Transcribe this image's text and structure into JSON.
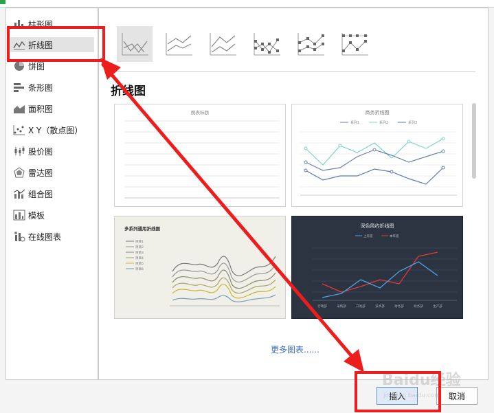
{
  "sidebar": {
    "items": [
      {
        "label": "柱形图",
        "icon": "bar-chart-icon"
      },
      {
        "label": "折线图",
        "icon": "line-chart-icon"
      },
      {
        "label": "饼图",
        "icon": "pie-chart-icon"
      },
      {
        "label": "条形图",
        "icon": "horizontal-bar-chart-icon"
      },
      {
        "label": "面积图",
        "icon": "area-chart-icon"
      },
      {
        "label": "X Y（散点图）",
        "icon": "scatter-chart-icon"
      },
      {
        "label": "股价图",
        "icon": "stock-chart-icon"
      },
      {
        "label": "雷达图",
        "icon": "radar-chart-icon"
      },
      {
        "label": "组合图",
        "icon": "combo-chart-icon"
      },
      {
        "label": "模板",
        "icon": "template-icon"
      },
      {
        "label": "在线图表",
        "icon": "online-chart-icon"
      }
    ],
    "selected_index": 1
  },
  "main": {
    "section_title": "折线图",
    "subtypes": [
      {
        "name": "line",
        "icon": "line-subtype-icon"
      },
      {
        "name": "stacked-line",
        "icon": "stacked-line-subtype-icon"
      },
      {
        "name": "percent-stacked-line",
        "icon": "percent-line-subtype-icon"
      },
      {
        "name": "line-markers",
        "icon": "line-markers-subtype-icon"
      },
      {
        "name": "stacked-line-markers",
        "icon": "stacked-line-markers-subtype-icon"
      },
      {
        "name": "percent-line-markers",
        "icon": "percent-line-markers-subtype-icon"
      }
    ],
    "templates": [
      {
        "title": "图表标题"
      },
      {
        "title": "商务折线图",
        "legend": [
          "系列1",
          "系列2",
          "系列3"
        ]
      },
      {
        "title": "多系列通用折线图",
        "legend": [
          "项目1",
          "项目2",
          "项目3",
          "项目4",
          "项目5",
          "项目6"
        ]
      },
      {
        "title": "深色简约折线图",
        "legend": [
          "上年度",
          "本年度"
        ],
        "categories": [
          "行政部",
          "采购部",
          "开发部",
          "技术部",
          "财务部",
          "财务部",
          "生产部"
        ]
      }
    ],
    "more_link": "更多图表......"
  },
  "buttons": {
    "insert": "插入",
    "cancel": "取消"
  },
  "watermark": {
    "text": "Baidu经验",
    "sub": "jingyan.baidu.com"
  },
  "colors": {
    "highlight": "#ee1d1d",
    "accent": "#3b6ec1",
    "dark_bg": "#2b3440"
  }
}
